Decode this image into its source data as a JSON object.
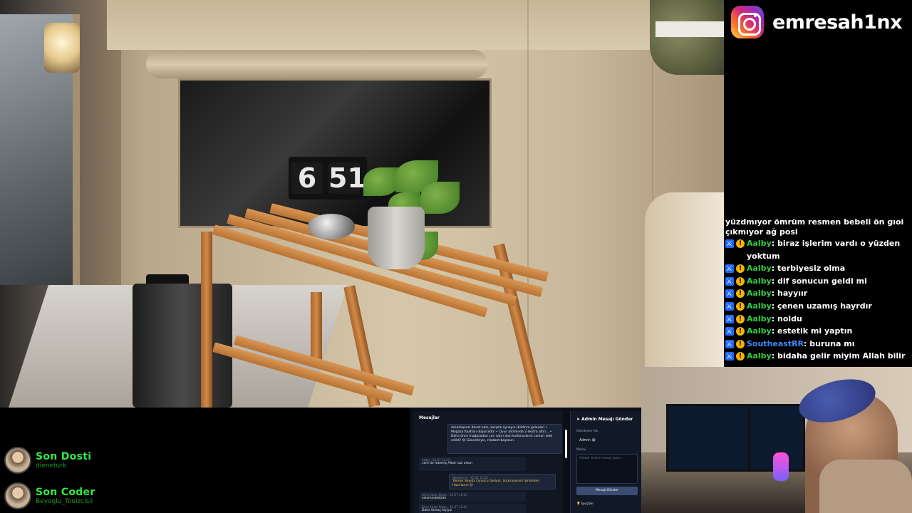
{
  "instagram": {
    "icon": "instagram-icon",
    "handle": "emresah1nx"
  },
  "clock": {
    "hour": "6",
    "minute": "51"
  },
  "chat": {
    "partial_message": "yüzdmıyor ömrüm resmen bebeli ön gıoi çıkmıyor ağ posi",
    "messages": [
      {
        "user": "Aalby",
        "color": "green",
        "text": "biraz işlerim vardı o yüzden yoktum"
      },
      {
        "user": "Aalby",
        "color": "green",
        "text": "terbiyesiz olma"
      },
      {
        "user": "Aalby",
        "color": "green",
        "text": "dif sonucun geldi mi"
      },
      {
        "user": "Aalby",
        "color": "green",
        "text": "hayyıır"
      },
      {
        "user": "Aalby",
        "color": "green",
        "text": "çenen uzamış hayrdır"
      },
      {
        "user": "Aalby",
        "color": "green",
        "text": "noldu"
      },
      {
        "user": "Aalby",
        "color": "green",
        "text": "estetik mi yaptın"
      },
      {
        "user": "SoutheastRR",
        "color": "blue",
        "text": "buruna mı"
      },
      {
        "user": "Aalby",
        "color": "green",
        "text": "bidaha gelir miyim Allah bilir"
      }
    ]
  },
  "followers": {
    "latest_follower": {
      "title": "Son Dosti",
      "name": "dieneturk"
    },
    "latest_coder": {
      "title": "Son Coder",
      "name": "Beyoglu_Tooizcisii"
    }
  },
  "admin_panel": {
    "messages_title": "Mesajlar",
    "announcement": "Arkadaşınızı davet edin, karşılık oynayın (bildirim gelecek) • Mağaza fiyatları düşürüldü! • Oyun bitiminde 2 ekstra altın... • Daha önce mağazadan can satın alan kullanıcıların canları iade edildi! 😃 Güncelleyin, rekabet başlasın.",
    "msg1_meta": "Aalby",
    "msg1_time": "15.07 11:23",
    "msg1_body": "cem de futemiş Allah razı olsun",
    "msg2_meta": "Yönetim 😃",
    "msg2_time": "15.07 11:24",
    "msg2_body": "Yüksek Sayıda Oyuncu Geliyor, Hazırlıyorum Şimdiden Hazırlanın 😃",
    "msg3_meta": "Birisi Adam Dolan",
    "msg3_time": "15.07 12:05",
    "msg3_body": "selamınaleküm",
    "msg4_meta": "Birisi Adam Dolan",
    "msg4_time": "15.07 12:45",
    "msg4_body": "Daha birkaç kişiyiz",
    "send_title": "Admin Mesajı Gönder",
    "sender_label": "Gönderen Adı",
    "sender_value": "Admin 😃",
    "message_label": "Mesaj",
    "message_placeholder": "Global chat'e mesaj yazın...",
    "send_button": "Mesajı Gönder",
    "tips_label": "İpuçları"
  }
}
